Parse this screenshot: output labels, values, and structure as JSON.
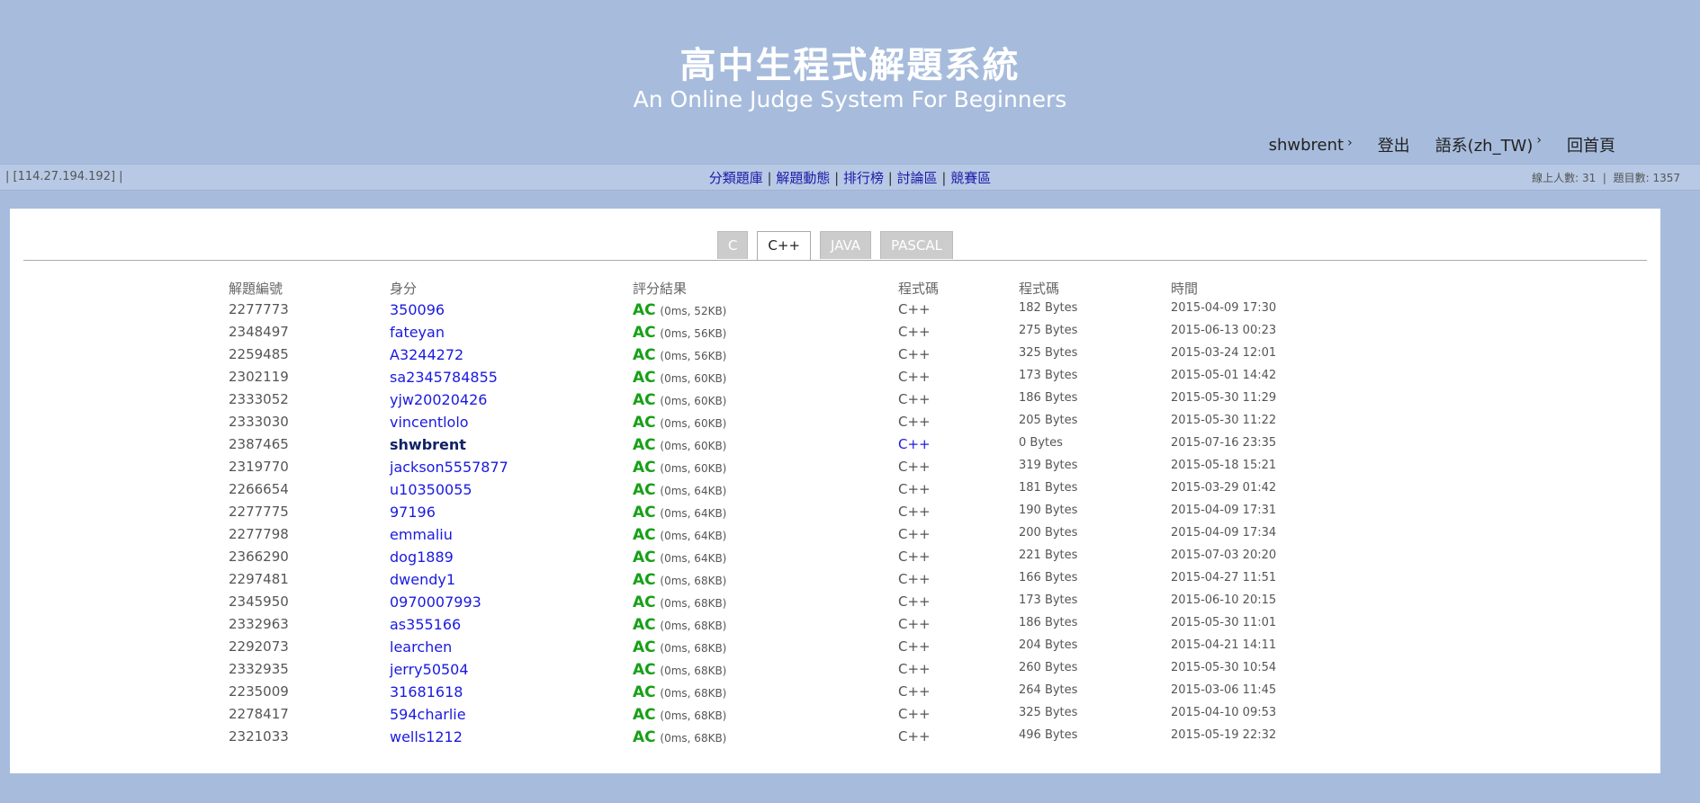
{
  "header": {
    "title_zh": "高中生程式解題系統",
    "title_en": "An Online Judge System For Beginners"
  },
  "usernav": {
    "username": "shwbrent",
    "logout": "登出",
    "language": "語系(zh_TW)",
    "home": "回首頁",
    "caret": "›"
  },
  "statusbar": {
    "ip": "| [114.27.194.192] |",
    "nav": [
      "分類題庫",
      "解題動態",
      "排行榜",
      "討論區",
      "競賽區"
    ],
    "separator": "|",
    "online": "線上人數: 31",
    "problems": "題目數: 1357",
    "stats_sep": "|"
  },
  "tabs": [
    {
      "label": "C",
      "active": false
    },
    {
      "label": "C++",
      "active": true
    },
    {
      "label": "JAVA",
      "active": false
    },
    {
      "label": "PASCAL",
      "active": false
    }
  ],
  "table": {
    "headers": [
      "解題編號",
      "身分",
      "評分結果",
      "程式碼",
      "程式碼",
      "時間"
    ],
    "rows": [
      {
        "id": "2277773",
        "user": "350096",
        "result": "AC",
        "detail": "(0ms, 52KB)",
        "lang": "C++",
        "size": "182 Bytes",
        "time": "2015-04-09 17:30"
      },
      {
        "id": "2348497",
        "user": "fateyan",
        "result": "AC",
        "detail": "(0ms, 56KB)",
        "lang": "C++",
        "size": "275 Bytes",
        "time": "2015-06-13 00:23"
      },
      {
        "id": "2259485",
        "user": "A3244272",
        "result": "AC",
        "detail": "(0ms, 56KB)",
        "lang": "C++",
        "size": "325 Bytes",
        "time": "2015-03-24 12:01"
      },
      {
        "id": "2302119",
        "user": "sa2345784855",
        "result": "AC",
        "detail": "(0ms, 60KB)",
        "lang": "C++",
        "size": "173 Bytes",
        "time": "2015-05-01 14:42"
      },
      {
        "id": "2333052",
        "user": "yjw20020426",
        "result": "AC",
        "detail": "(0ms, 60KB)",
        "lang": "C++",
        "size": "186 Bytes",
        "time": "2015-05-30 11:29"
      },
      {
        "id": "2333030",
        "user": "vincentlolo",
        "result": "AC",
        "detail": "(0ms, 60KB)",
        "lang": "C++",
        "size": "205 Bytes",
        "time": "2015-05-30 11:22"
      },
      {
        "id": "2387465",
        "user": "shwbrent",
        "result": "AC",
        "detail": "(0ms, 60KB)",
        "lang": "C++",
        "size": "0 Bytes",
        "time": "2015-07-16 23:35",
        "me": true
      },
      {
        "id": "2319770",
        "user": "jackson5557877",
        "result": "AC",
        "detail": "(0ms, 60KB)",
        "lang": "C++",
        "size": "319 Bytes",
        "time": "2015-05-18 15:21"
      },
      {
        "id": "2266654",
        "user": "u10350055",
        "result": "AC",
        "detail": "(0ms, 64KB)",
        "lang": "C++",
        "size": "181 Bytes",
        "time": "2015-03-29 01:42"
      },
      {
        "id": "2277775",
        "user": "97196",
        "result": "AC",
        "detail": "(0ms, 64KB)",
        "lang": "C++",
        "size": "190 Bytes",
        "time": "2015-04-09 17:31"
      },
      {
        "id": "2277798",
        "user": "emmaliu",
        "result": "AC",
        "detail": "(0ms, 64KB)",
        "lang": "C++",
        "size": "200 Bytes",
        "time": "2015-04-09 17:34"
      },
      {
        "id": "2366290",
        "user": "dog1889",
        "result": "AC",
        "detail": "(0ms, 64KB)",
        "lang": "C++",
        "size": "221 Bytes",
        "time": "2015-07-03 20:20"
      },
      {
        "id": "2297481",
        "user": "dwendy1",
        "result": "AC",
        "detail": "(0ms, 68KB)",
        "lang": "C++",
        "size": "166 Bytes",
        "time": "2015-04-27 11:51"
      },
      {
        "id": "2345950",
        "user": "0970007993",
        "result": "AC",
        "detail": "(0ms, 68KB)",
        "lang": "C++",
        "size": "173 Bytes",
        "time": "2015-06-10 20:15"
      },
      {
        "id": "2332963",
        "user": "as355166",
        "result": "AC",
        "detail": "(0ms, 68KB)",
        "lang": "C++",
        "size": "186 Bytes",
        "time": "2015-05-30 11:01"
      },
      {
        "id": "2292073",
        "user": "learchen",
        "result": "AC",
        "detail": "(0ms, 68KB)",
        "lang": "C++",
        "size": "204 Bytes",
        "time": "2015-04-21 14:11"
      },
      {
        "id": "2332935",
        "user": "jerry50504",
        "result": "AC",
        "detail": "(0ms, 68KB)",
        "lang": "C++",
        "size": "260 Bytes",
        "time": "2015-05-30 10:54"
      },
      {
        "id": "2235009",
        "user": "31681618",
        "result": "AC",
        "detail": "(0ms, 68KB)",
        "lang": "C++",
        "size": "264 Bytes",
        "time": "2015-03-06 11:45"
      },
      {
        "id": "2278417",
        "user": "594charlie",
        "result": "AC",
        "detail": "(0ms, 68KB)",
        "lang": "C++",
        "size": "325 Bytes",
        "time": "2015-04-10 09:53"
      },
      {
        "id": "2321033",
        "user": "wells1212",
        "result": "AC",
        "detail": "(0ms, 68KB)",
        "lang": "C++",
        "size": "496 Bytes",
        "time": "2015-05-19 22:32"
      }
    ]
  },
  "colors": {
    "background": "#a7bcdc",
    "link": "#1a1ae0",
    "accepted": "#17a017"
  }
}
